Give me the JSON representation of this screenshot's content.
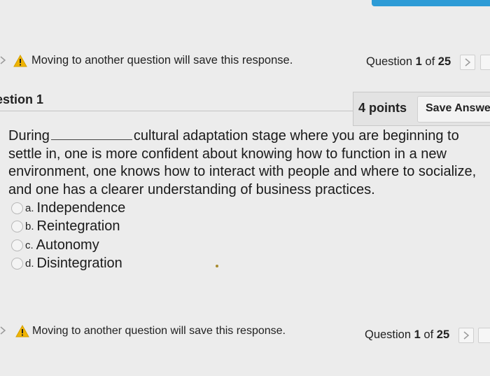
{
  "nav": {
    "warning_text": "Moving to another question will save this response.",
    "counter_prefix": "Question",
    "counter_current": "1",
    "counter_sep": "of",
    "counter_total": "25"
  },
  "question": {
    "title": "estion 1",
    "points": "4 points",
    "save_label": "Save Answe",
    "text_before_blank": "During",
    "text_after_blank": "cultural adaptation stage where you are beginning to settle in, one is more confident about knowing how to function in a new environment, one knows how to interact with people and where to socialize, and one has a clearer understanding of business practices.",
    "options": [
      {
        "letter": "a.",
        "text": "Independence"
      },
      {
        "letter": "b.",
        "text": "Reintegration"
      },
      {
        "letter": "c.",
        "text": "Autonomy"
      },
      {
        "letter": "d.",
        "text": "Disintegration"
      }
    ]
  },
  "colors": {
    "accent": "#2d9bd6",
    "warning": "#f0b400"
  },
  "icons": {
    "warning": "warning-icon",
    "next": "chevron-right-icon"
  }
}
